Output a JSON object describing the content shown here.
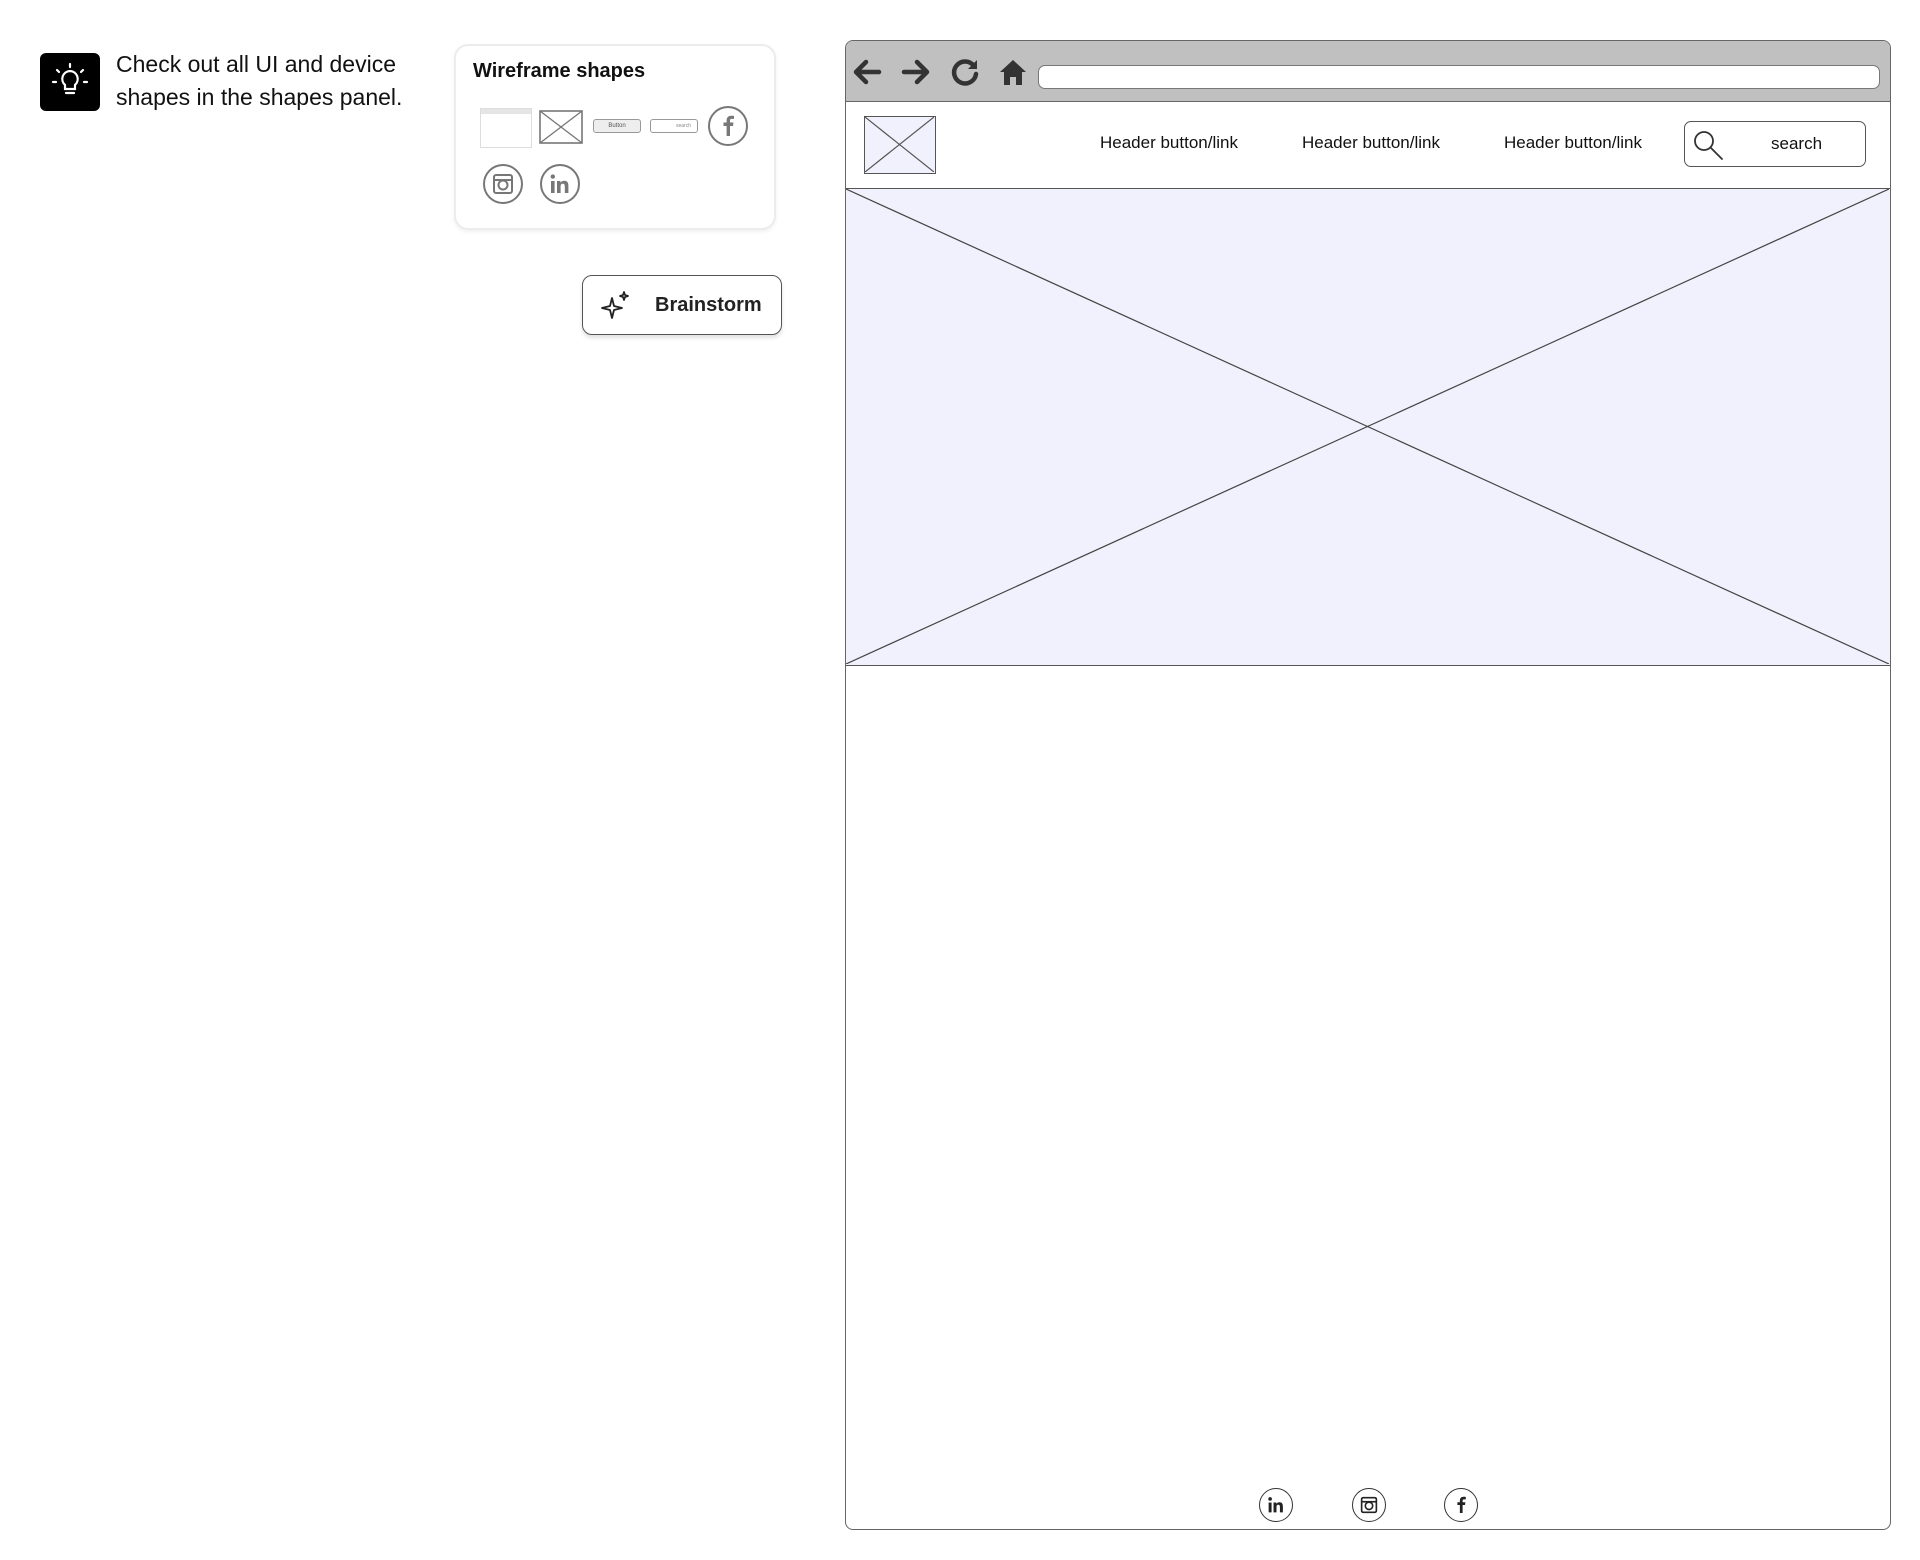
{
  "tip": {
    "icon": "lightbulb-icon",
    "text": "Check out all UI and device shapes in the shapes panel."
  },
  "shapes_panel": {
    "title": "Wireframe shapes",
    "thumbs": [
      "browser-shape",
      "image-placeholder-shape",
      "button-shape",
      "search-shape",
      "facebook-icon",
      "instagram-icon",
      "linkedin-icon"
    ],
    "button_thumb_label": "Button",
    "search_thumb_label": "search"
  },
  "brainstorm": {
    "label": "Brainstorm",
    "icon": "sparkle-icon"
  },
  "browser": {
    "toolbar_icons": [
      "arrow-left-icon",
      "arrow-right-icon",
      "reload-icon",
      "home-icon"
    ],
    "address": "",
    "header_links": [
      "Header button/link",
      "Header button/link",
      "Header button/link"
    ],
    "search_placeholder": "search",
    "footer_social": [
      "linkedin-icon",
      "instagram-icon",
      "facebook-icon"
    ]
  },
  "colors": {
    "toolbar": "#c0c0c0",
    "placeholder_fill": "#f0f1fc",
    "stroke": "#555555",
    "tip_icon_bg": "#000000"
  }
}
